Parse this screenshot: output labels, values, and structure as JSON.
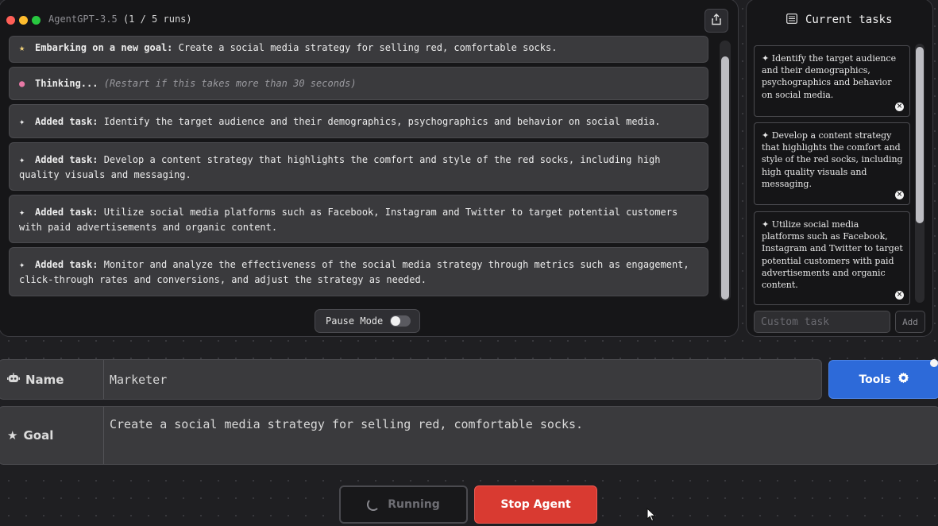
{
  "chat": {
    "title_app": "AgentGPT-3.5",
    "title_runs": "(1 / 5 runs)",
    "messages": [
      {
        "icon": "star-icon",
        "label": "Embarking on a new goal:",
        "text": " Create a social media strategy for selling red, comfortable socks."
      },
      {
        "icon": "brain-icon",
        "label": "Thinking...",
        "hint": "(Restart if this takes more than 30 seconds)"
      },
      {
        "icon": "pin-icon",
        "label": "Added task:",
        "text": " Identify the target audience and their demographics, psychographics and behavior on social media."
      },
      {
        "icon": "pin-icon",
        "label": "Added task:",
        "text": " Develop a content strategy that highlights the comfort and style of the red socks, including high quality visuals and messaging."
      },
      {
        "icon": "pin-icon",
        "label": "Added task:",
        "text": " Utilize social media platforms such as Facebook, Instagram and Twitter to target potential customers with paid advertisements and organic content."
      },
      {
        "icon": "pin-icon",
        "label": "Added task:",
        "text": " Monitor and analyze the effectiveness of the social media strategy through metrics such as engagement, click-through rates and conversions, and adjust the strategy as needed."
      }
    ],
    "pause_mode_label": "Pause Mode",
    "pause_mode_on": false
  },
  "tasks": {
    "header": "Current tasks",
    "items": [
      "Identify the target audience and their demographics, psychographics and behavior on social media.",
      "Develop a content strategy that highlights the comfort and style of the red socks, including high quality visuals and messaging.",
      "Utilize social media platforms such as Facebook, Instagram and Twitter to target potential customers with paid advertisements and organic content."
    ],
    "custom_task_placeholder": "Custom task",
    "add_label": "Add"
  },
  "form": {
    "name_label": "Name",
    "name_value": "Marketer",
    "goal_label": "Goal",
    "goal_value": "Create a social media strategy for selling red, comfortable socks.",
    "tools_label": "Tools"
  },
  "actions": {
    "running_label": "Running",
    "stop_label": "Stop Agent"
  },
  "colors": {
    "tools_blue": "#2d6ad9",
    "stop_red": "#d93a31",
    "thinking_pink": "#e879a6"
  }
}
